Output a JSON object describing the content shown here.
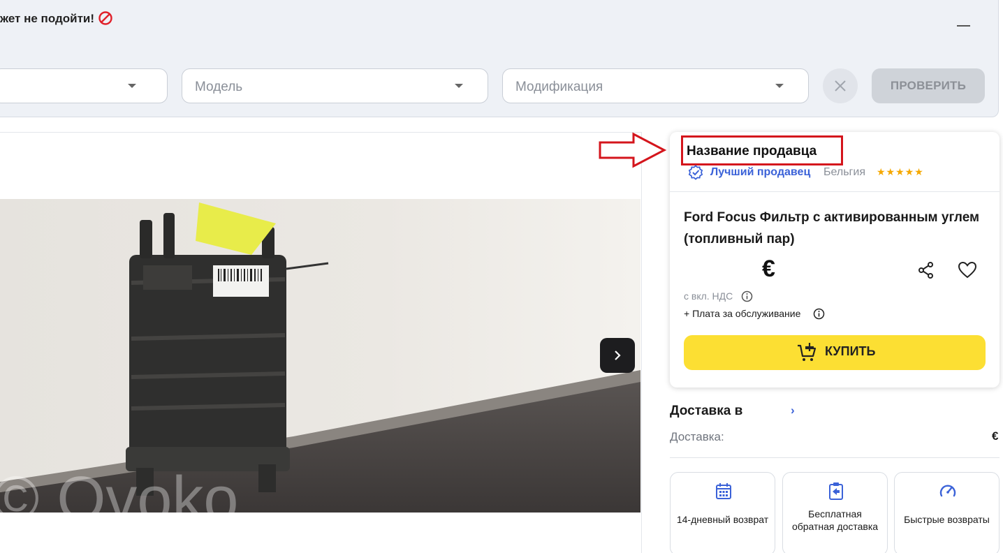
{
  "checker": {
    "warning_text": "жет не подойти!",
    "make_placeholder": "",
    "model_placeholder": "Модель",
    "modification_placeholder": "Модификация",
    "check_button": "ПРОВЕРИТЬ"
  },
  "seller": {
    "name": "Название продавца",
    "badge": "Лучший продавец",
    "country": "Бельгия",
    "rating_stars": "★★★★★",
    "rating": 5
  },
  "product": {
    "title": "Ford Focus Фильтр с активированным углем (топливный пар)",
    "price_currency": "€",
    "vat_note": "с вкл. НДС",
    "service_fee": "+ Плата за обслуживание",
    "buy_button": "КУПИТЬ",
    "photo_watermark": "© Ovoko"
  },
  "delivery": {
    "title": "Доставка в",
    "chevron": "›",
    "label": "Доставка:",
    "price": "€"
  },
  "features": [
    {
      "icon": "calendar-icon",
      "text": "14-дневный возврат"
    },
    {
      "icon": "return-box-icon",
      "text": "Бесплатная обратная доставка"
    },
    {
      "icon": "speedometer-icon",
      "text": "Быстрые возвраты"
    }
  ],
  "colors": {
    "accent_blue": "#3b62d8",
    "buy_yellow": "#fcdf33",
    "annotation_red": "#d4151c",
    "star_gold": "#f5a800"
  }
}
